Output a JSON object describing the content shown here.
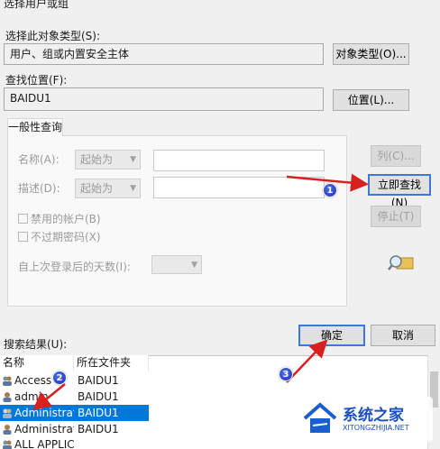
{
  "dialog": {
    "title": "选择用户或组"
  },
  "object_type": {
    "label": "选择此对象类型(S):",
    "value": "用户、组或内置安全主体",
    "button": "对象类型(O)..."
  },
  "location": {
    "label": "查找位置(F):",
    "value": "BAIDU1",
    "button": "位置(L)..."
  },
  "tab": {
    "label": "一般性查询"
  },
  "query": {
    "name_label": "名称(A):",
    "name_mode": "起始为",
    "desc_label": "描述(D):",
    "desc_mode": "起始为",
    "disabled_accounts": "禁用的帐户(B)",
    "no_expire_pwd": "不过期密码(X)",
    "days_label": "自上次登录后的天数(I):"
  },
  "buttons": {
    "columns": "列(C)...",
    "find_now": "立即查找(N)",
    "stop": "停止(T)",
    "ok": "确定",
    "cancel": "取消"
  },
  "results": {
    "label": "搜索结果(U):",
    "columns": [
      "名称",
      "所在文件夹"
    ],
    "rows": [
      {
        "name": "Access C",
        "folder": "BAIDU1"
      },
      {
        "name": "admin",
        "folder": "BAIDU1"
      },
      {
        "name": "Administrat...",
        "folder": "BAIDU1",
        "selected": true
      },
      {
        "name": "Administrat...",
        "folder": "BAIDU1"
      },
      {
        "name": "ALL APPLIC...",
        "folder": ""
      }
    ]
  },
  "callouts": [
    "1",
    "2",
    "3"
  ],
  "watermark": {
    "name": "系统之家",
    "url": "XITONGZHIJIA.NET"
  },
  "colors": {
    "accent": "#0078d7",
    "arrow": "#d82020",
    "callout": "#2440c8"
  }
}
